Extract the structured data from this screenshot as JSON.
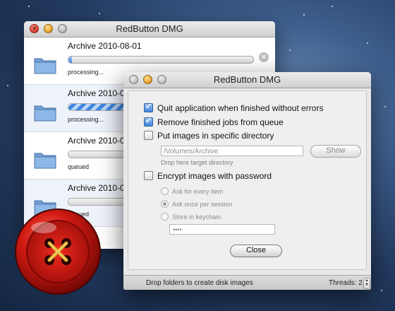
{
  "app_title": "RedButton DMG",
  "queue_window": {
    "title": "RedButton DMG",
    "items": [
      {
        "name": "Archive 2010-08-01",
        "progress": 0.02,
        "status": "processing...",
        "active": true
      },
      {
        "name": "Archive 2010-0",
        "progress": 0.55,
        "status": "processing...",
        "active": false
      },
      {
        "name": "Archive 2010-0",
        "progress": 0.0,
        "status": "queued",
        "active": false
      },
      {
        "name": "Archive 2010-0",
        "progress": 0.0,
        "status": "queued",
        "active": false
      }
    ]
  },
  "options_window": {
    "title": "RedButton DMG",
    "options": {
      "quit_on_finish": {
        "label": "Quit application when finished without errors",
        "checked": true
      },
      "remove_finished": {
        "label": "Remove finished jobs from queue",
        "checked": true
      },
      "put_in_dir": {
        "label": "Put images in specific directory",
        "checked": false
      },
      "encrypt": {
        "label": "Encrypt images with password",
        "checked": false
      }
    },
    "directory": {
      "path": "/Volumes/Archive",
      "show_label": "Show",
      "hint": "Drop here target directory"
    },
    "password": {
      "choices": [
        {
          "label": "Ask for every item",
          "selected": false
        },
        {
          "label": "Ask once per session",
          "selected": true
        },
        {
          "label": "Store in keychain",
          "selected": false
        }
      ],
      "value": "••••"
    },
    "close_label": "Close",
    "status_text": "Drop folders to create disk images",
    "threads_label": "Threads: 2",
    "threads_value": 2
  },
  "colors": {
    "accent": "#3f86e0",
    "close_red": "#e0402f"
  }
}
